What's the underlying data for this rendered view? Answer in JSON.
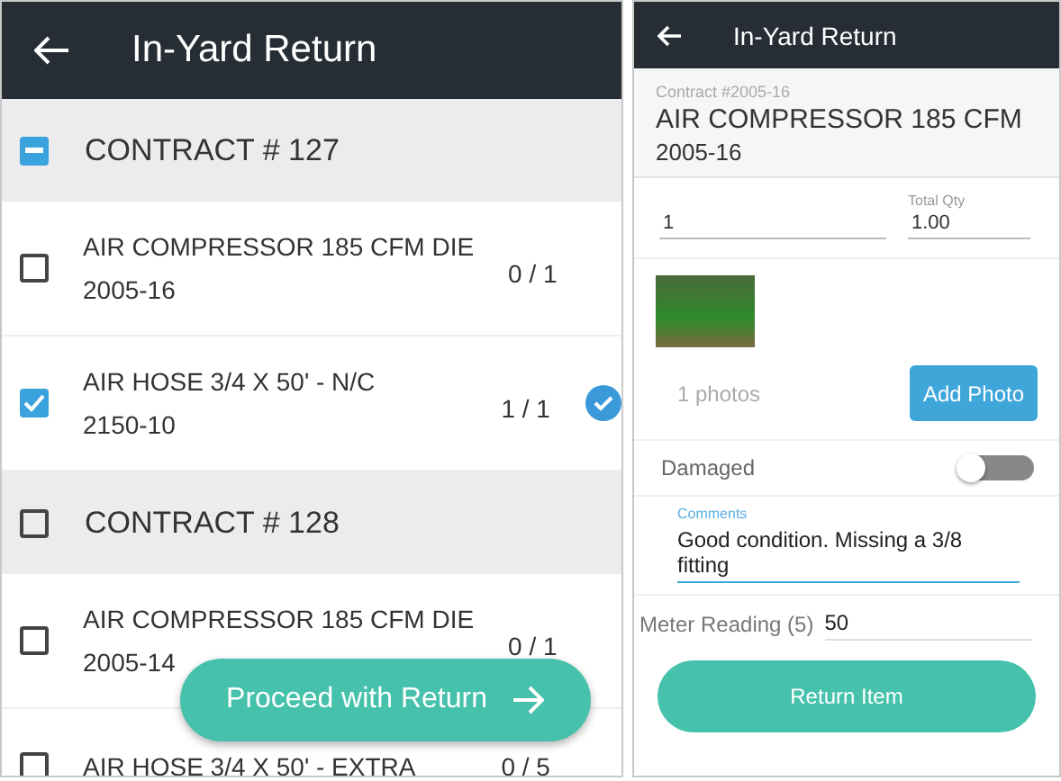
{
  "list_screen": {
    "title": "In-Yard Return",
    "groups": [
      {
        "label": "CONTRACT # 127",
        "kind": "partial",
        "items": [
          {
            "name": "AIR COMPRESSOR 185 CFM DIE",
            "code": "2005-16",
            "count": "0 / 1",
            "checked": false,
            "complete": false
          },
          {
            "name": "AIR HOSE 3/4 X 50' - N/C",
            "code": "2150-10",
            "count": "1 / 1",
            "checked": true,
            "complete": true
          }
        ]
      },
      {
        "label": "CONTRACT # 128",
        "kind": "unchecked",
        "items": [
          {
            "name": "AIR COMPRESSOR 185 CFM DIE",
            "code": "2005-14",
            "count": "0 / 1",
            "checked": false,
            "complete": false
          },
          {
            "name": "AIR HOSE 3/4 X 50' - EXTRA",
            "count": "0 / 5",
            "checked": false,
            "complete": false
          }
        ]
      }
    ],
    "proceed_button": "Proceed with Return"
  },
  "detail_screen": {
    "title": "In-Yard Return",
    "contract": "Contract #2005-16",
    "item_name": "AIR COMPRESSOR 185 CFM",
    "item_code": "2005-16",
    "quantity": {
      "value": "1"
    },
    "total_qty": {
      "label": "Total Qty",
      "value": "1.00"
    },
    "photos_count": "1 photos",
    "add_photo_button": "Add Photo",
    "damaged": {
      "label": "Damaged",
      "on": false
    },
    "comments": {
      "label": "Comments",
      "value": "Good condition. Missing a 3/8 fitting"
    },
    "meter_reading": {
      "label": "Meter Reading (5)",
      "value": "50"
    },
    "return_button": "Return Item"
  }
}
